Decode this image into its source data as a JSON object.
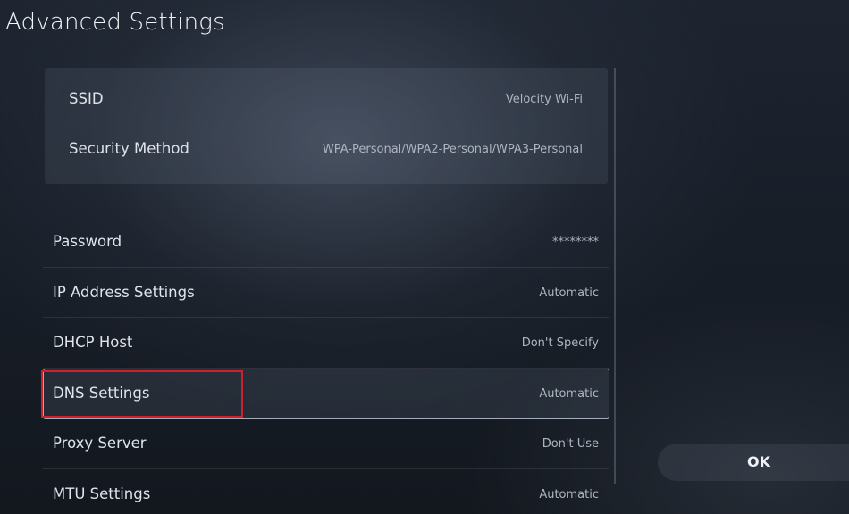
{
  "header": {
    "title": "Advanced Settings"
  },
  "wifi_info": {
    "rows": [
      {
        "label": "SSID",
        "value": "Velocity Wi-Fi"
      },
      {
        "label": "Security Method",
        "value": "WPA-Personal/WPA2-Personal/WPA3-Personal"
      }
    ]
  },
  "settings": {
    "items": [
      {
        "label": "Password",
        "value": "********"
      },
      {
        "label": "IP Address Settings",
        "value": "Automatic"
      },
      {
        "label": "DHCP Host",
        "value": "Don't Specify"
      },
      {
        "label": "DNS Settings",
        "value": "Automatic",
        "focused": true
      },
      {
        "label": "Proxy Server",
        "value": "Don't Use"
      },
      {
        "label": "MTU Settings",
        "value": "Automatic"
      }
    ]
  },
  "actions": {
    "ok_label": "OK"
  },
  "colors": {
    "focus_outline": "#cdd7e4",
    "annotation_highlight": "#d0202c"
  }
}
